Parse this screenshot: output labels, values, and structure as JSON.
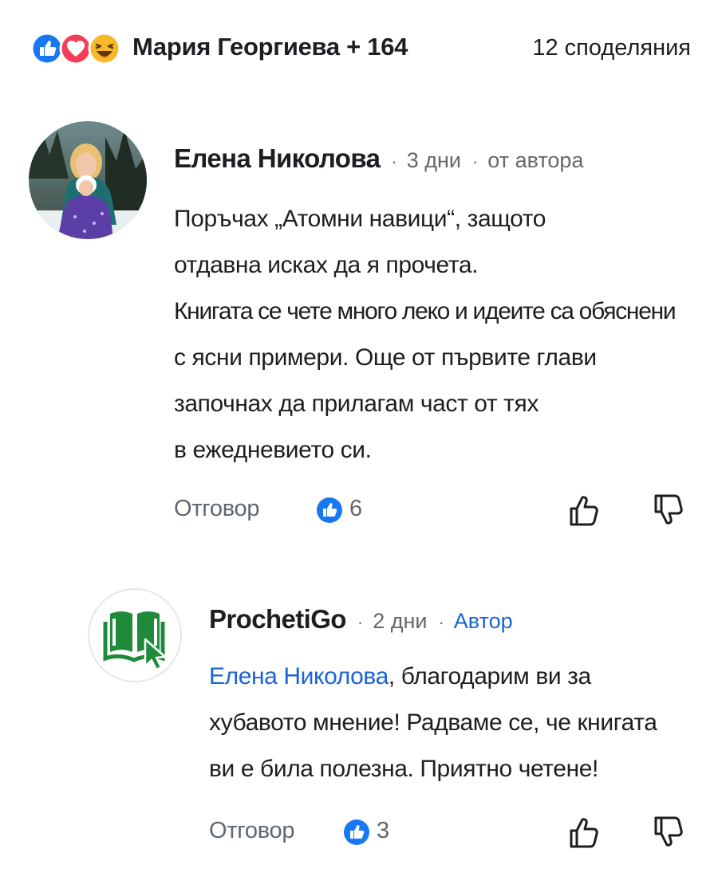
{
  "reactions_bar": {
    "reactions": [
      "like-icon",
      "love-icon",
      "haha-icon"
    ],
    "reactors_label": "Мария Георгиева + 164",
    "shares_label": "12 споделяния"
  },
  "comments": [
    {
      "author": "Елена Николова",
      "time": "3 дни",
      "tag": "от автора",
      "lines": [
        "Поръчах „Атомни навици“, защото",
        "отдавна исках да я прочета.",
        "Книгата се чете много леко и идеите са обяснени",
        "с ясни примери. Още от първите глави",
        "започнах да прилагам част от тях",
        "в ежедневието си."
      ],
      "reply_label": "Отговор",
      "likes": "6"
    }
  ],
  "reply": {
    "author": "ProchetiGo",
    "time": "2 дни",
    "tag": "Автор",
    "mention": "Елена Николова",
    "lines": [
      ", благодарим ви за",
      "хубавото мнение! Радваме се, че книгата",
      "ви е била полезна. Приятно четене!"
    ],
    "reply_label": "Отговор",
    "likes": "3"
  },
  "colors": {
    "brand_blue": "#1a63d6",
    "like_blue": "#1877f2",
    "love_red": "#f33e58",
    "haha_yellow": "#f7b928",
    "logo_green": "#1f8a3a",
    "muted_text": "#65676b"
  }
}
